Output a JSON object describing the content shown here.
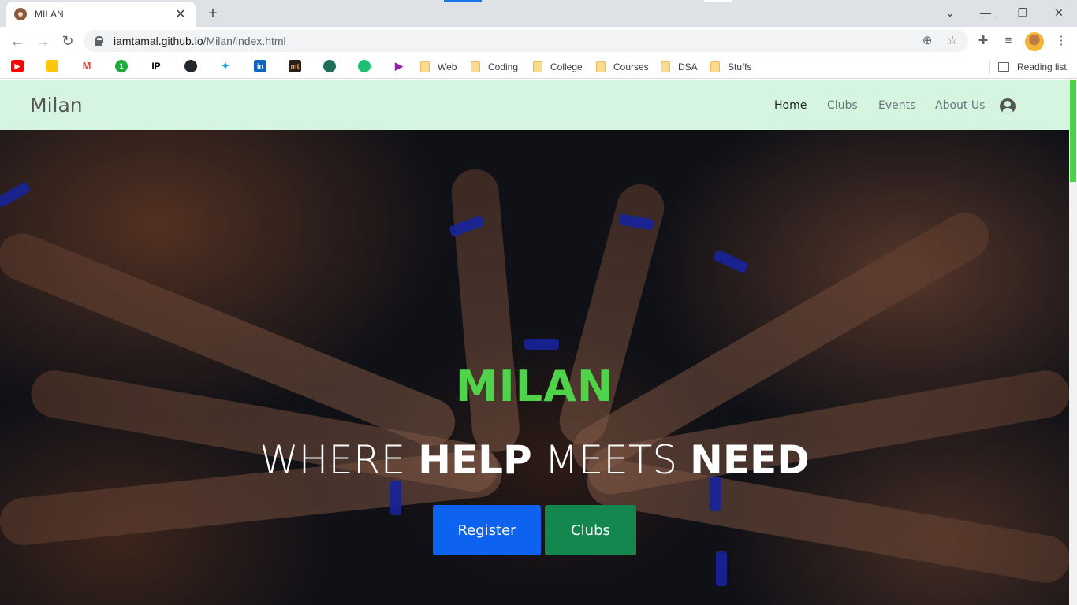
{
  "browser": {
    "tab_title": "MILAN",
    "tab_close": "✕",
    "new_tab": "+",
    "url_host": "iamtamal.github.io",
    "url_path": "/Milan/index.html",
    "reading_list": "Reading list",
    "bookmarks": {
      "folders": [
        "Web",
        "Coding",
        "College",
        "Courses",
        "DSA",
        "Stuffs"
      ],
      "ip_label": "IP"
    }
  },
  "site": {
    "brand": "Milan",
    "nav": {
      "home": "Home",
      "clubs": "Clubs",
      "events": "Events",
      "about": "About Us"
    },
    "hero": {
      "title": "MILAN",
      "tagline_1": "WHERE ",
      "tagline_2": "HELP",
      "tagline_3": " MEETS ",
      "tagline_4": "NEED",
      "register": "Register",
      "clubs": "Clubs"
    }
  },
  "colors": {
    "nav_bg": "#d5f5e1",
    "hero_title": "#4fd34a",
    "register_btn": "#0d63f0",
    "clubs_btn": "#14874f"
  }
}
